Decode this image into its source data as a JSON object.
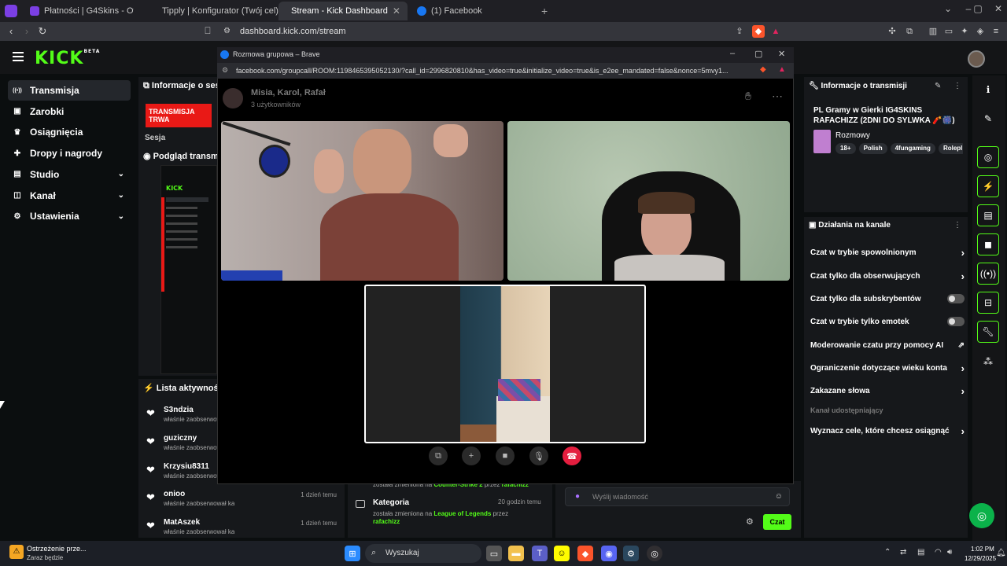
{
  "browser": {
    "tabs": [
      {
        "label": "Płatności | G4Skins - Otwieraj skrzynk",
        "active": false,
        "color": "#7b3fe4"
      },
      {
        "label": "Tipply | Konfigurator (Twój cel)",
        "active": false,
        "color": "#ffffff"
      },
      {
        "label": "Stream - Kick Dashboard",
        "active": true,
        "color": "#53fc18"
      },
      {
        "label": "(1) Facebook",
        "active": false,
        "color": "#1877f2"
      }
    ],
    "url": "dashboard.kick.com/stream",
    "new_tab": "+"
  },
  "kick": {
    "logo": "KICK",
    "logo_beta": "BETA",
    "sidebar": [
      {
        "label": "Transmisja",
        "icon": "broadcast-icon",
        "active": true,
        "chevron": false
      },
      {
        "label": "Zarobki",
        "icon": "wallet-icon",
        "active": false,
        "chevron": false
      },
      {
        "label": "Osiągnięcia",
        "icon": "trophy-icon",
        "active": false,
        "chevron": false
      },
      {
        "label": "Dropy i nagrody",
        "icon": "gift-icon",
        "active": false,
        "chevron": false
      },
      {
        "label": "Studio",
        "icon": "studio-icon",
        "active": false,
        "chevron": true
      },
      {
        "label": "Kanał",
        "icon": "channel-icon",
        "active": false,
        "chevron": true
      },
      {
        "label": "Ustawienia",
        "icon": "gear-icon",
        "active": false,
        "chevron": true
      }
    ],
    "session_header": "Informacje o sesji",
    "live_badge": "TRANSMISJA TRWA",
    "session_label": "Sesja",
    "preview_header": "Podgląd transmisji",
    "activity_header": "Lista aktywności",
    "activity": [
      {
        "name": "S3ndzia",
        "text": "właśnie zaobserwował kanał",
        "time": ""
      },
      {
        "name": "guziczny",
        "text": "właśnie zaobserwował kanał",
        "time": ""
      },
      {
        "name": "Krzysiu8311",
        "text": "właśnie zaobserwował kanał",
        "time": ""
      },
      {
        "name": "onioo",
        "text": "właśnie zaobserwował kanał",
        "time": "1 dzień temu"
      },
      {
        "name": "MatAszek",
        "text": "właśnie zaobserwował kanał",
        "time": "1 dzień temu"
      }
    ],
    "category_events": [
      {
        "prefix": "została zmieniona na",
        "game": "Counter-Strike 2",
        "by": "przez",
        "user": "rafachizz"
      },
      {
        "title": "Kategoria",
        "time": "20 godzin temu",
        "prefix": "została zmieniona na",
        "game": "League of Legends",
        "by": "przez",
        "user": "rafachizz"
      }
    ],
    "chat_placeholder": "Wyślij wiadomość",
    "chat_button": "Czat",
    "stream_info_header": "Informacje o transmisji",
    "stream_title": "PL Gramy w Gierki IG4SKINS RAFACHIZZ (2DNI DO SYLWKA 🧨🎆)",
    "category_name": "Rozmowy",
    "tags": [
      "18+",
      "Polish",
      "4fungaming",
      "Rolepl"
    ],
    "actions_header": "Działania na kanale",
    "actions": [
      {
        "label": "Czat w trybie spowolnionym",
        "kind": "chevron"
      },
      {
        "label": "Czat tylko dla obserwujących",
        "kind": "chevron"
      },
      {
        "label": "Czat tylko dla subskrybentów",
        "kind": "toggle"
      },
      {
        "label": "Czat w trybie tylko emotek",
        "kind": "toggle"
      },
      {
        "label": "Moderowanie czatu przy pomocy AI",
        "kind": "external"
      },
      {
        "label": "Ograniczenie dotyczące wieku konta",
        "kind": "chevron"
      },
      {
        "label": "Zakazane słowa",
        "kind": "chevron"
      }
    ],
    "shared_channel": "Kanał udostępniający",
    "goals": "Wyznacz cele, które chcesz osiągnąć"
  },
  "popup": {
    "title": "Rozmowa grupowa – Brave",
    "url": "facebook.com/groupcall/ROOM:1198465395052130/?call_id=2996820810&has_video=true&initialize_video=true&is_e2ee_mandated=false&nonce=5mvy1...",
    "call_name": "Misia, Karol, Rafał",
    "call_count": "3 użytkowników"
  },
  "taskbar": {
    "notification_title": "Ostrzeżenie prze...",
    "notification_sub": "Zaraz będzie",
    "search": "Wyszukaj",
    "time": "1:02 PM",
    "date": "12/29/2025"
  }
}
